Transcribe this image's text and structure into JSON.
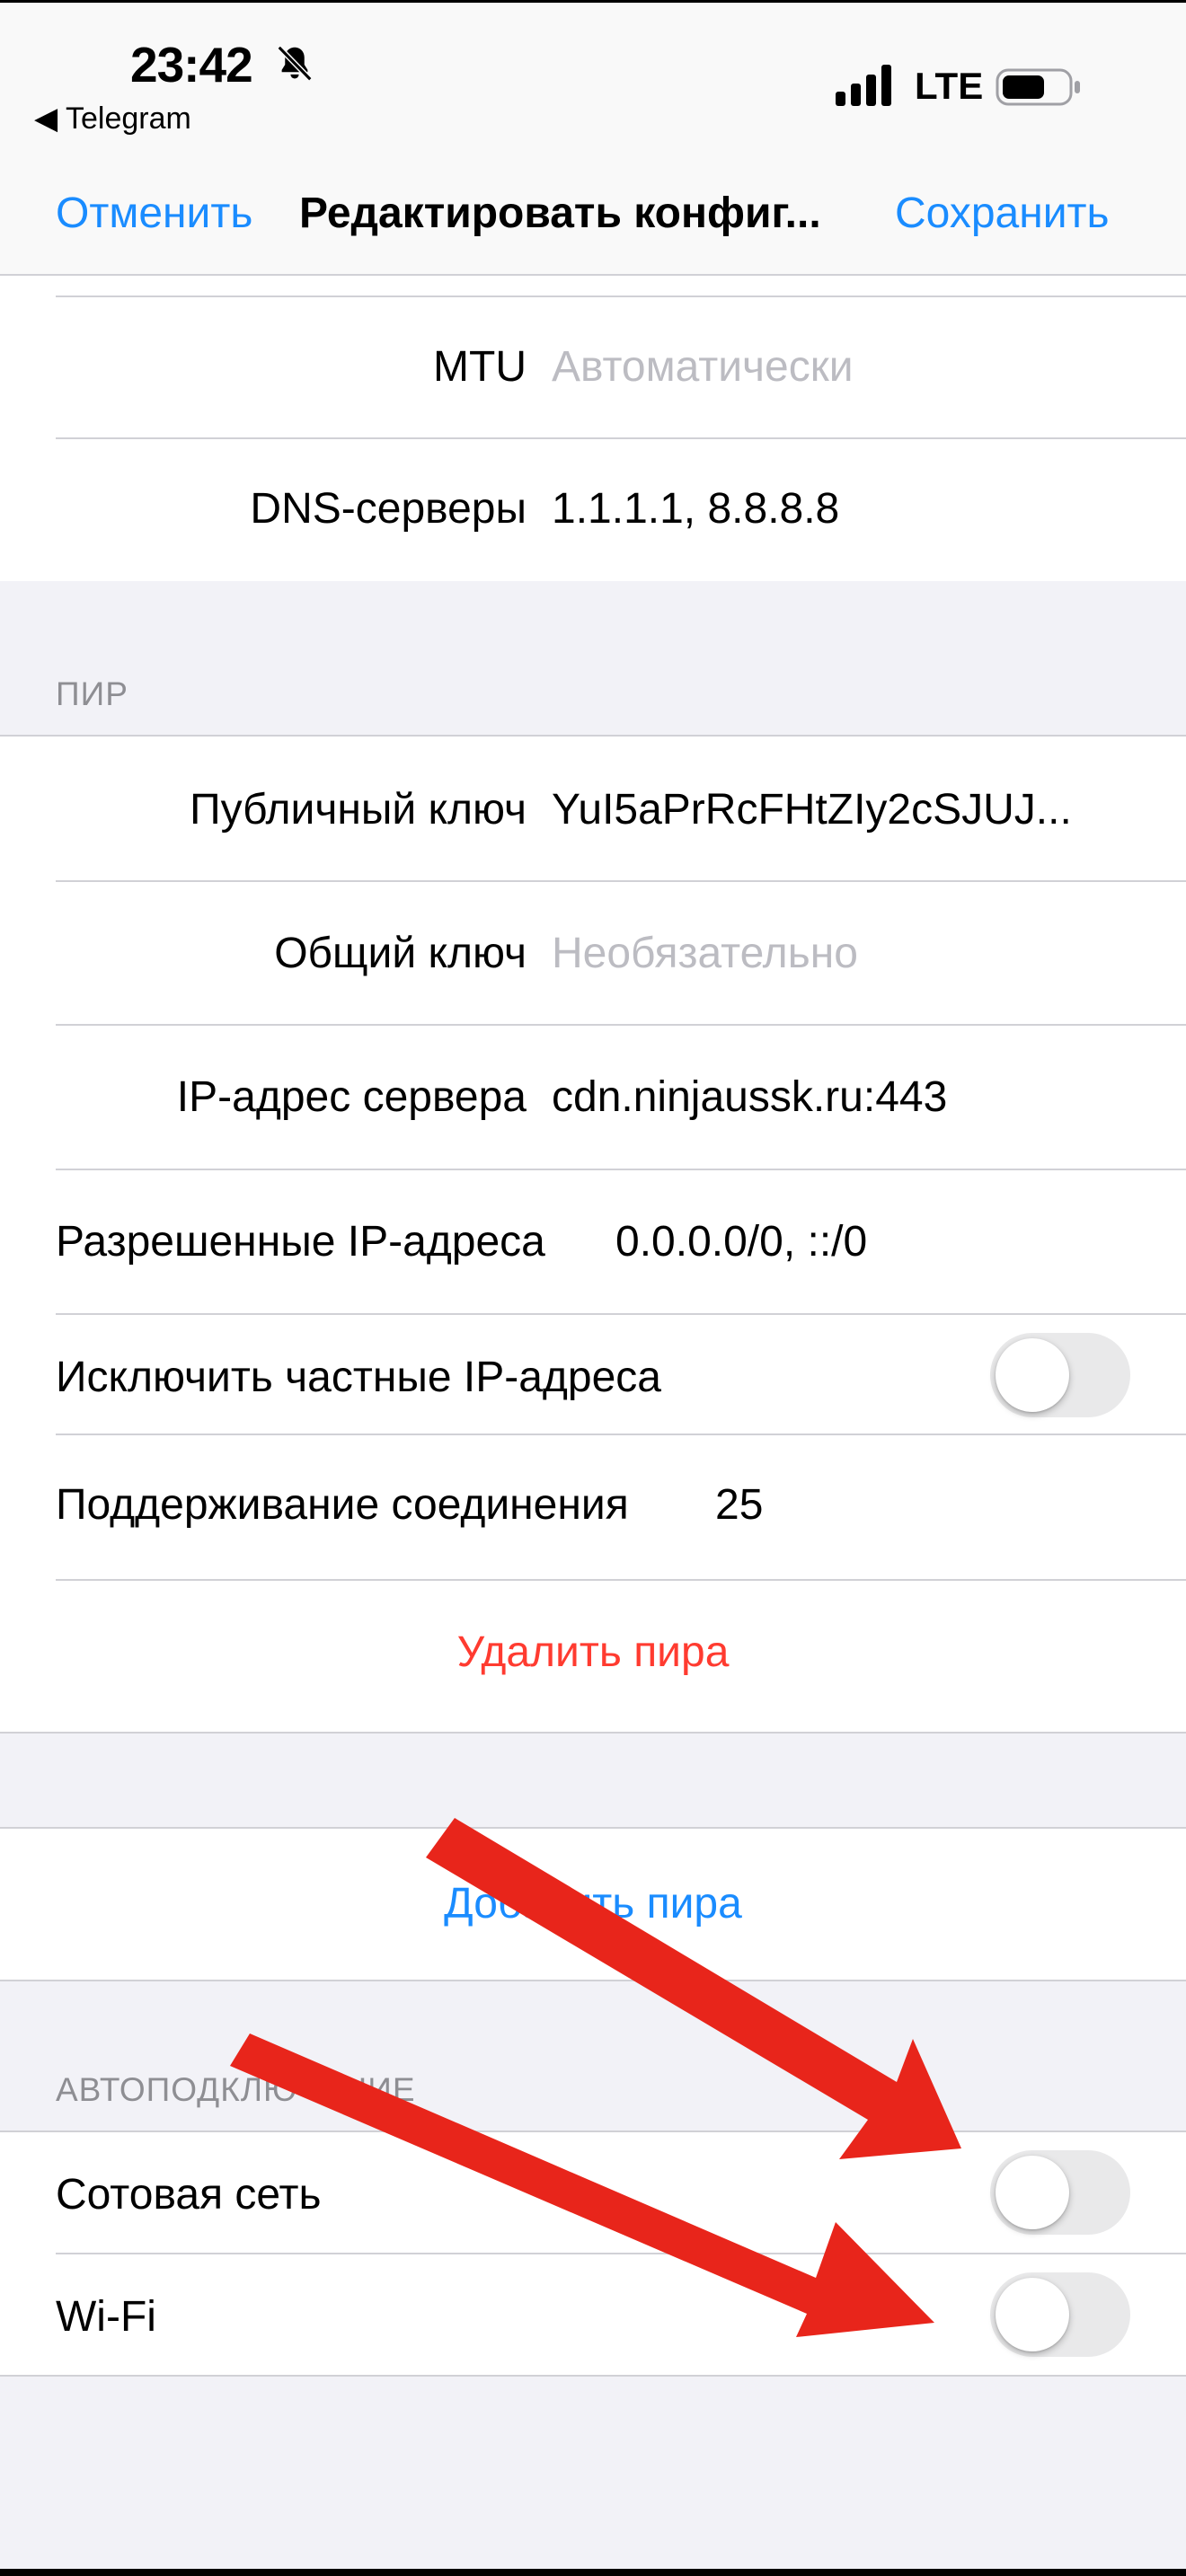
{
  "status_bar": {
    "time": "23:42",
    "back_app": "◀ Telegram",
    "network": "LTE"
  },
  "nav": {
    "cancel": "Отменить",
    "title": "Редактировать конфиг...",
    "save": "Сохранить"
  },
  "interface": {
    "mtu_label": "MTU",
    "mtu_placeholder": "Автоматически",
    "dns_label": "DNS-серверы",
    "dns_value": "1.1.1.1, 8.8.8.8"
  },
  "peer": {
    "header": "ПИР",
    "public_key_label": "Публичный ключ",
    "public_key_value": "YuI5aPrRcFHtZIy2cSJUJ...",
    "preshared_key_label": "Общий ключ",
    "preshared_key_placeholder": "Необязательно",
    "endpoint_label": "IP-адрес сервера",
    "endpoint_value": "cdn.ninjaussk.ru:443",
    "allowed_ips_label": "Разрешенные IP-адреса",
    "allowed_ips_value": "0.0.0.0/0, ::/0",
    "exclude_private_label": "Исключить частные IP-адреса",
    "exclude_private_on": false,
    "keepalive_label": "Поддерживание соединения",
    "keepalive_value": "25",
    "delete_peer": "Удалить пира"
  },
  "add_peer": "Добавить пира",
  "on_demand": {
    "header": "АВТОПОДКЛЮЧЕНИЕ",
    "cellular_label": "Сотовая сеть",
    "cellular_on": false,
    "wifi_label": "Wi-Fi",
    "wifi_on": false
  },
  "colors": {
    "accent": "#1a8cff",
    "destructive": "#ff3b30",
    "annotation_arrow": "#e8251b"
  },
  "icons": [
    "bell-slash-icon",
    "cellular-signal-icon",
    "battery-icon",
    "red-arrow-annotation"
  ]
}
